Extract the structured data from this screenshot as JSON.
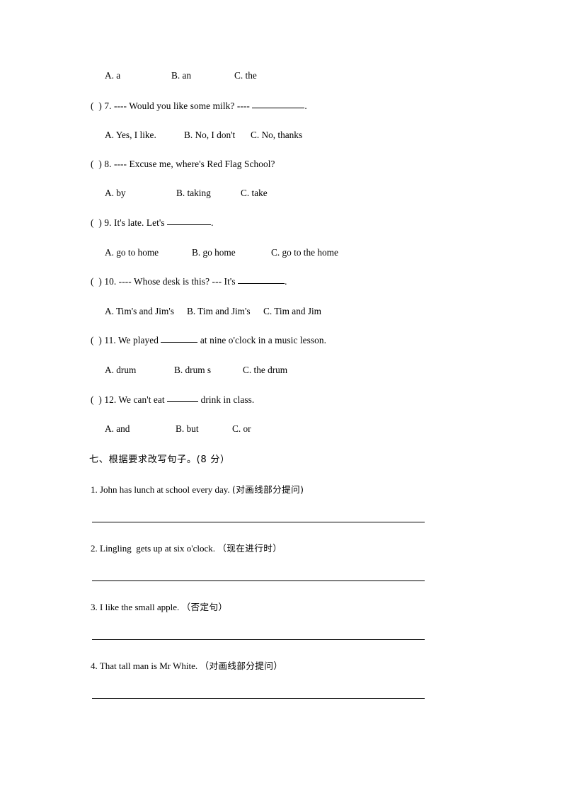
{
  "document": {
    "type": "english-exam-worksheet",
    "page_background": "#ffffff",
    "text_color": "#000000"
  },
  "multiple_choice": {
    "orphan_options_row": {
      "a": "A. a",
      "b": "B. an",
      "c": "C. the"
    },
    "questions": [
      {
        "number": "7",
        "marker": "(  ) 7.",
        "stem_before": " ---- Would you like some milk? ---- ",
        "stem_after": ".",
        "options": {
          "a": "A. Yes, I like.",
          "b": "B. No, I don't",
          "c": "C. No, thanks"
        }
      },
      {
        "number": "8",
        "marker": "(  ) 8.",
        "stem_before": " ---- Excuse me, where's Red Flag School?",
        "stem_after": "",
        "options": {
          "a": "A. by",
          "b": "B. taking",
          "c": "C. take"
        }
      },
      {
        "number": "9",
        "marker": "(  ) 9.",
        "stem_before": " It's late. Let's ",
        "stem_after": ".",
        "options": {
          "a": "A. go to home",
          "b": "B. go home",
          "c": "C. go to the home"
        }
      },
      {
        "number": "10",
        "marker": "(  ) 10.",
        "stem_before": " ---- Whose desk is this? --- It's ",
        "stem_after": ".",
        "options": {
          "a": "A. Tim's and Jim's",
          "b": "B. Tim and Jim's",
          "c": "C. Tim and Jim"
        }
      },
      {
        "number": "11",
        "marker": "(  ) 11.",
        "stem_before": " We played ",
        "stem_after": " at nine o'clock in a music lesson.",
        "options": {
          "a": "A. drum",
          "b": "B. drum s",
          "c": "C. the drum"
        }
      },
      {
        "number": "12",
        "marker": "(  ) 12.",
        "stem_before": " We can't eat ",
        "stem_after": " drink in class.",
        "options": {
          "a": "A. and",
          "b": "B. but",
          "c": "C. or"
        }
      }
    ]
  },
  "rewrite_section": {
    "heading": "七、根据要求改写句子。(8 分）",
    "items": [
      {
        "number": "1.",
        "sentence": " John has lunch at school every day. ",
        "instruction": "(对画线部分提问)"
      },
      {
        "number": "2.",
        "sentence": " Lingling  gets up at six o'clock. ",
        "instruction": "（现在进行时）"
      },
      {
        "number": "3.",
        "sentence": " I like the small apple. ",
        "instruction": "（否定句）"
      },
      {
        "number": "4.",
        "sentence": " That tall man is Mr White. ",
        "instruction": "（对画线部分提问）"
      }
    ]
  }
}
